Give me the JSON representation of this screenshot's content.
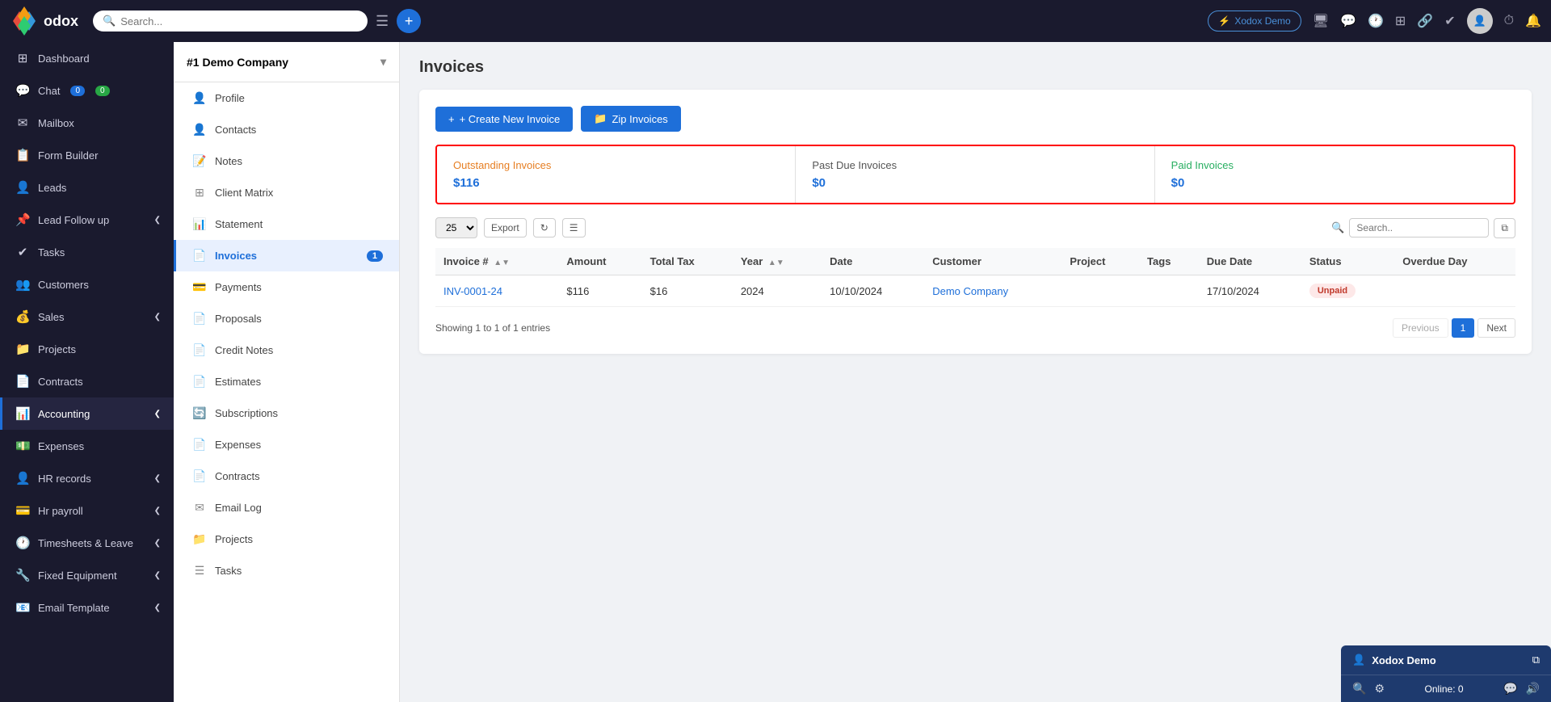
{
  "navbar": {
    "logo_text": "odox",
    "search_placeholder": "Search...",
    "company_btn": "Xodox Demo",
    "plus_icon": "+",
    "icons": [
      "monitor-icon",
      "chat-bubble-icon",
      "history-icon",
      "grid-icon",
      "share-icon",
      "check-icon",
      "clock-icon",
      "bell-icon"
    ]
  },
  "sidebar": {
    "items": [
      {
        "id": "dashboard",
        "label": "Dashboard",
        "icon": "⊞"
      },
      {
        "id": "chat",
        "label": "Chat",
        "icon": "💬",
        "badge1": "0",
        "badge2": "0"
      },
      {
        "id": "mailbox",
        "label": "Mailbox",
        "icon": "✉"
      },
      {
        "id": "form-builder",
        "label": "Form Builder",
        "icon": "📋"
      },
      {
        "id": "leads",
        "label": "Leads",
        "icon": "👤"
      },
      {
        "id": "lead-followup",
        "label": "Lead Follow up",
        "icon": "📌",
        "arrow": "❮"
      },
      {
        "id": "tasks",
        "label": "Tasks",
        "icon": "✔"
      },
      {
        "id": "customers",
        "label": "Customers",
        "icon": "👥"
      },
      {
        "id": "sales",
        "label": "Sales",
        "icon": "💰",
        "arrow": "❮"
      },
      {
        "id": "projects",
        "label": "Projects",
        "icon": "📁"
      },
      {
        "id": "contracts",
        "label": "Contracts",
        "icon": "📄"
      },
      {
        "id": "accounting",
        "label": "Accounting",
        "icon": "📊",
        "arrow": "❮",
        "active": true
      },
      {
        "id": "expenses",
        "label": "Expenses",
        "icon": "💵"
      },
      {
        "id": "hr-records",
        "label": "HR records",
        "icon": "👤",
        "arrow": "❮"
      },
      {
        "id": "hr-payroll",
        "label": "Hr payroll",
        "icon": "💳",
        "arrow": "❮"
      },
      {
        "id": "timesheets",
        "label": "Timesheets & Leave",
        "icon": "🕐",
        "arrow": "❮"
      },
      {
        "id": "fixed-equipment",
        "label": "Fixed Equipment",
        "icon": "🔧",
        "arrow": "❮"
      },
      {
        "id": "email-template",
        "label": "Email Template",
        "icon": "📧",
        "arrow": "❮"
      }
    ]
  },
  "secondary_sidebar": {
    "company_name": "#1 Demo Company",
    "items": [
      {
        "id": "profile",
        "label": "Profile",
        "icon": "👤"
      },
      {
        "id": "contacts",
        "label": "Contacts",
        "icon": "👤"
      },
      {
        "id": "notes",
        "label": "Notes",
        "icon": "📝"
      },
      {
        "id": "client-matrix",
        "label": "Client Matrix",
        "icon": "⊞"
      },
      {
        "id": "statement",
        "label": "Statement",
        "icon": "📊"
      },
      {
        "id": "invoices",
        "label": "Invoices",
        "icon": "📄",
        "badge": "1",
        "active": true
      },
      {
        "id": "payments",
        "label": "Payments",
        "icon": "💳"
      },
      {
        "id": "proposals",
        "label": "Proposals",
        "icon": "📄"
      },
      {
        "id": "credit-notes",
        "label": "Credit Notes",
        "icon": "📄"
      },
      {
        "id": "estimates",
        "label": "Estimates",
        "icon": "📄"
      },
      {
        "id": "subscriptions",
        "label": "Subscriptions",
        "icon": "🔄"
      },
      {
        "id": "expenses",
        "label": "Expenses",
        "icon": "📄"
      },
      {
        "id": "contracts",
        "label": "Contracts",
        "icon": "📄"
      },
      {
        "id": "email-log",
        "label": "Email Log",
        "icon": "✉"
      },
      {
        "id": "projects",
        "label": "Projects",
        "icon": "📁"
      },
      {
        "id": "tasks",
        "label": "Tasks",
        "icon": "☰"
      }
    ]
  },
  "main": {
    "page_title": "Invoices",
    "buttons": {
      "create_invoice": "+ Create New Invoice",
      "zip_invoices": "Zip Invoices"
    },
    "stats": {
      "outstanding": {
        "label": "Outstanding Invoices",
        "value": "$116"
      },
      "past_due": {
        "label": "Past Due Invoices",
        "value": "$0"
      },
      "paid": {
        "label": "Paid Invoices",
        "value": "$0"
      }
    },
    "table_controls": {
      "per_page": "25",
      "export_label": "Export",
      "search_placeholder": "Search.."
    },
    "table": {
      "columns": [
        "Invoice #",
        "Amount",
        "Total Tax",
        "Year",
        "Date",
        "Customer",
        "Project",
        "Tags",
        "Due Date",
        "Status",
        "Overdue Day"
      ],
      "rows": [
        {
          "invoice_num": "INV-0001-24",
          "amount": "$116",
          "total_tax": "$16",
          "year": "2024",
          "date": "10/10/2024",
          "customer": "Demo Company",
          "project": "",
          "tags": "",
          "due_date": "17/10/2024",
          "status": "Unpaid",
          "overdue_day": ""
        }
      ]
    },
    "pagination": {
      "showing_text": "Showing 1 to 1 of 1 entries",
      "previous": "Previous",
      "next": "Next",
      "current_page": "1"
    }
  },
  "chat_widget": {
    "title": "Xodox Demo",
    "online_text": "Online: 0"
  }
}
